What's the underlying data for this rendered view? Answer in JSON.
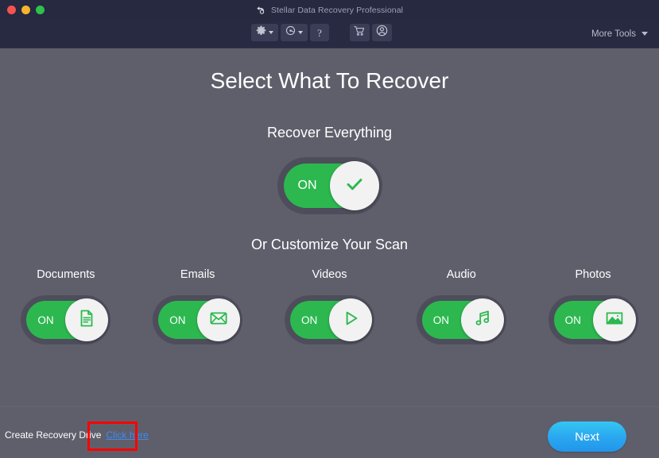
{
  "window": {
    "title": "Stellar Data Recovery Professional",
    "title_icon": "undo-back-icon",
    "traffic_lights": [
      {
        "name": "close",
        "color": "#f4534f"
      },
      {
        "name": "minimize",
        "color": "#f7b42c"
      },
      {
        "name": "maximize",
        "color": "#2ec14b"
      }
    ]
  },
  "toolbar": {
    "settings": {
      "icon": "gear-icon",
      "has_caret": true
    },
    "history": {
      "icon": "recovery-history-icon",
      "has_caret": true
    },
    "help": {
      "icon": "question-mark-icon",
      "label": "?"
    },
    "cart": {
      "icon": "shopping-cart-icon"
    },
    "account": {
      "icon": "user-account-icon"
    },
    "more_tools_label": "More Tools",
    "more_tools_caret": "chevron-down-icon"
  },
  "main": {
    "page_title": "Select What To Recover",
    "recover_everything_label": "Recover Everything",
    "recover_everything_toggle": {
      "state": "ON",
      "on_text": "ON",
      "knob_icon": "checkmark-icon"
    },
    "customize_label": "Or Customize Your Scan",
    "categories": [
      {
        "label": "Documents",
        "state": "ON",
        "on_text": "ON",
        "icon": "document-icon"
      },
      {
        "label": "Emails",
        "state": "ON",
        "on_text": "ON",
        "icon": "envelope-icon"
      },
      {
        "label": "Videos",
        "state": "ON",
        "on_text": "ON",
        "icon": "play-triangle-icon"
      },
      {
        "label": "Audio",
        "state": "ON",
        "on_text": "ON",
        "icon": "music-note-icon"
      },
      {
        "label": "Photos",
        "state": "ON",
        "on_text": "ON",
        "icon": "photo-image-icon"
      }
    ]
  },
  "footer": {
    "recovery_drive_label": "Create Recovery Drive",
    "click_here_link": "Click here",
    "next_button_label": "Next"
  },
  "colors": {
    "header_bg": "#272a41",
    "titlebar_bg": "#262940",
    "main_bg": "#5f5f6c",
    "toggle_track": "#4d4d5b",
    "toggle_green": "#2cb84f",
    "knob": "#f2f2f2",
    "link_blue": "#3b8bf5",
    "next_blue": "#2aa6ef",
    "highlight_red": "#ff0000"
  }
}
